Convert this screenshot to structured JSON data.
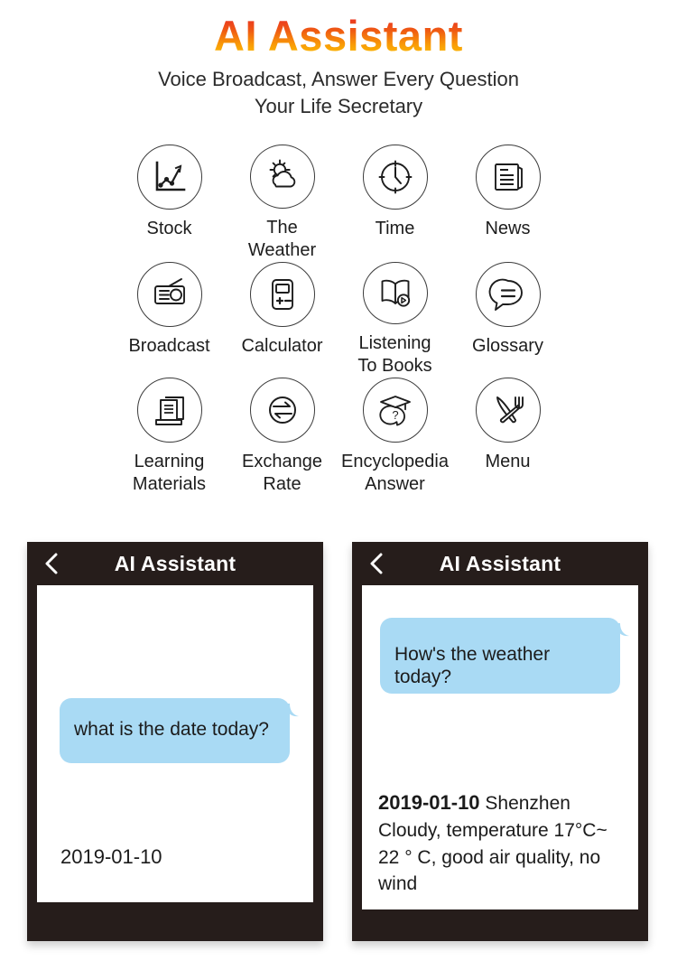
{
  "hero": {
    "title": "AI Assistant",
    "subtitle_line1": "Voice Broadcast, Answer Every Question",
    "subtitle_line2": "Your Life Secretary",
    "title_gradient_top": "#e8252a",
    "title_gradient_bottom": "#fbc900"
  },
  "features": {
    "rows": [
      [
        {
          "label": "Stock",
          "icon": "stock-chart-icon"
        },
        {
          "label": "The\nWeather",
          "icon": "sun-cloud-icon"
        },
        {
          "label": "Time",
          "icon": "clock-icon"
        },
        {
          "label": "News",
          "icon": "newspaper-icon"
        }
      ],
      [
        {
          "label": "Broadcast",
          "icon": "radio-icon"
        },
        {
          "label": "Calculator",
          "icon": "calculator-icon"
        },
        {
          "label": "Listening\nTo Books",
          "icon": "book-play-icon"
        },
        {
          "label": "Glossary",
          "icon": "speech-bubble-equals-icon"
        }
      ],
      [
        {
          "label": "Learning\nMaterials",
          "icon": "documents-icon"
        },
        {
          "label": "Exchange\nRate",
          "icon": "exchange-arrows-icon"
        },
        {
          "label": "Encyclopedia\nAnswer",
          "icon": "graduation-question-icon"
        },
        {
          "label": "Menu",
          "icon": "fork-knife-icon"
        }
      ]
    ]
  },
  "phones": {
    "frame_color": "#261d1b",
    "bubble_color": "#a9daf4",
    "left": {
      "back_icon": "back-chevron-icon",
      "title": "AI Assistant",
      "question": "what is the date today?",
      "answer": "2019-01-10"
    },
    "right": {
      "back_icon": "back-chevron-icon",
      "title": "AI Assistant",
      "question": "How's the weather today?",
      "answer_date": "2019-01-10",
      "answer_location": " Shenzhen",
      "answer_line2": "Cloudy, temperature 17°C~",
      "answer_line3": "22 ° C, good air quality, no wind"
    }
  }
}
